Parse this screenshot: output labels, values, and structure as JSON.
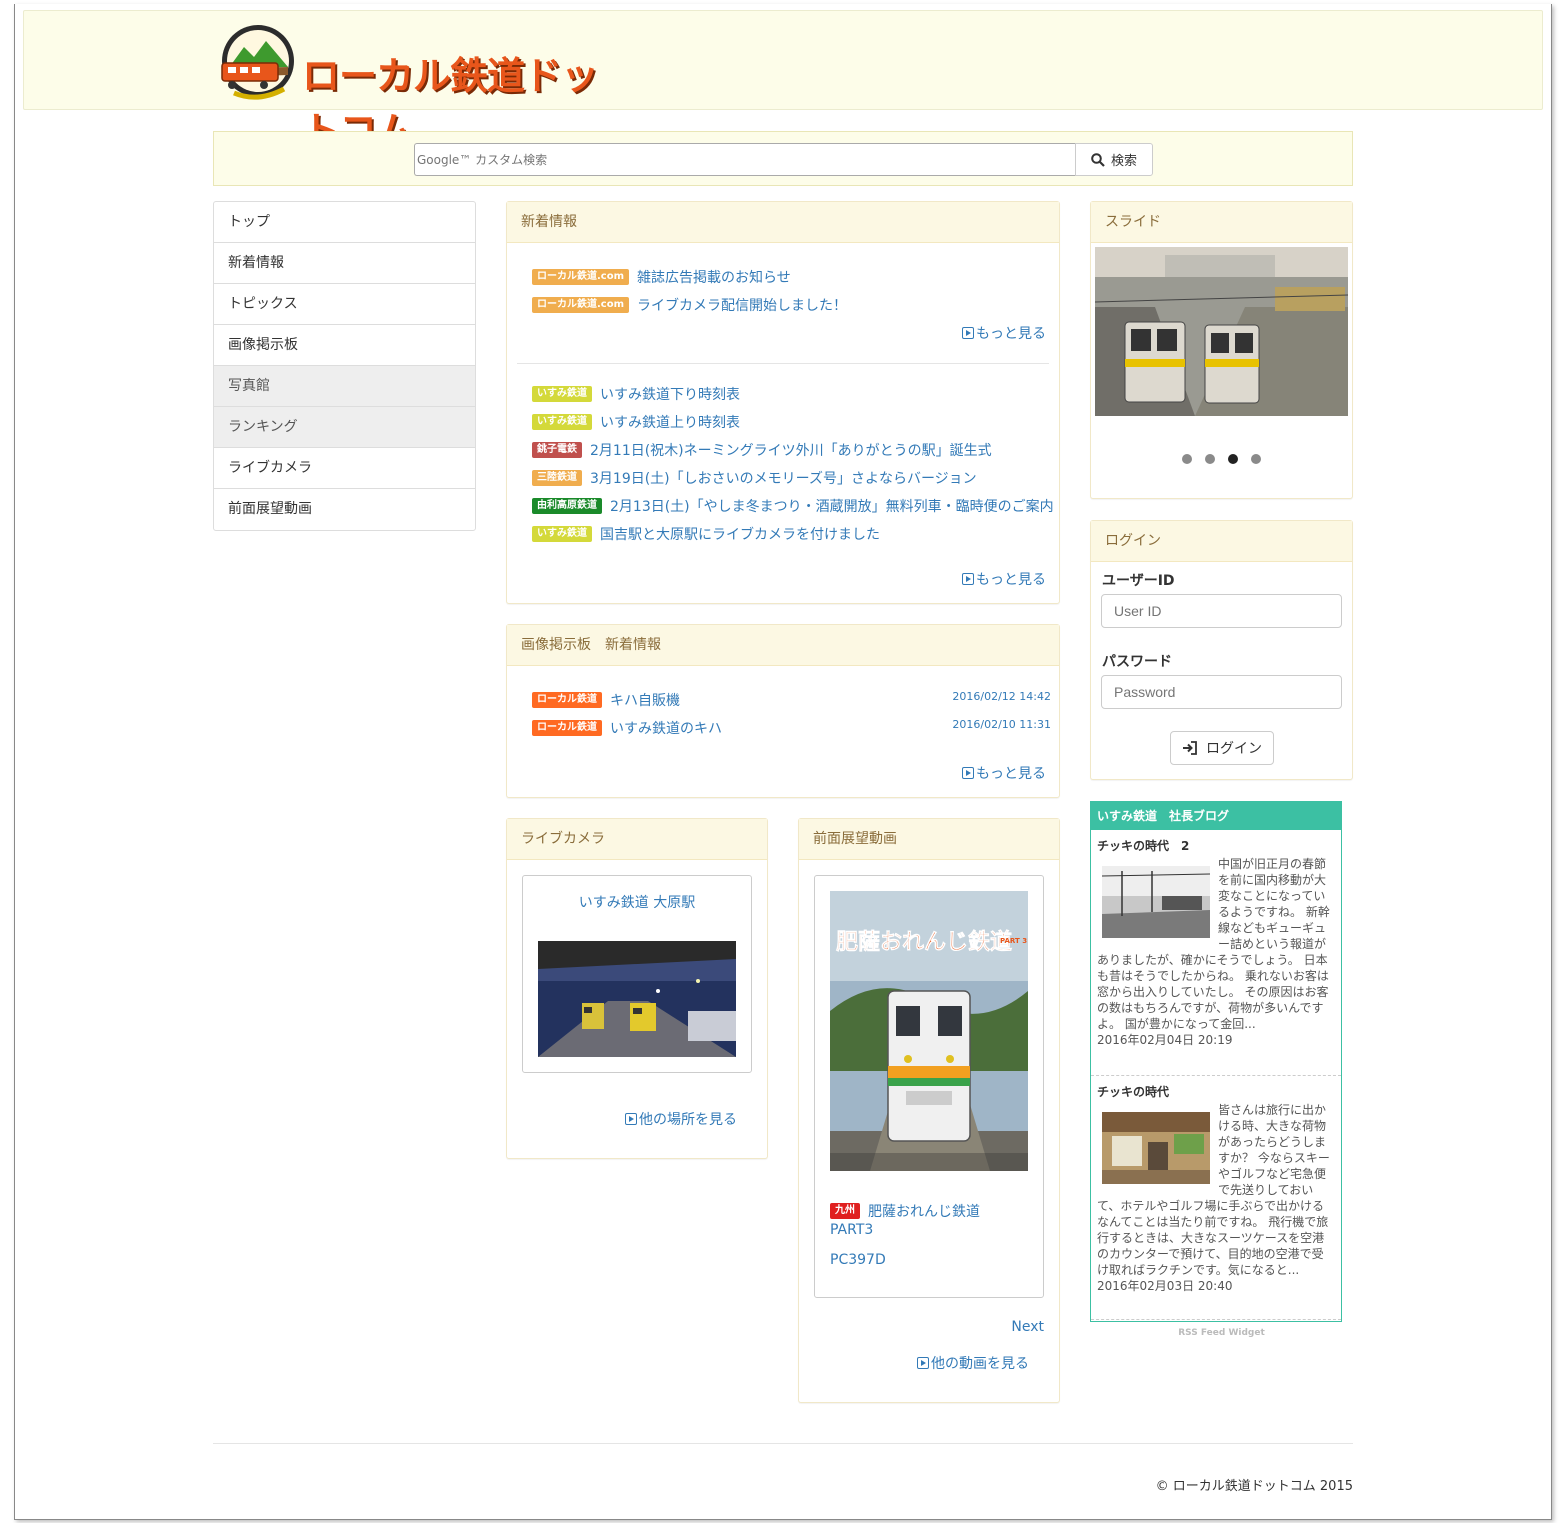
{
  "header": {
    "logo_text": "ローカル鉄道ドットコム"
  },
  "search": {
    "placeholder": "Google™ カスタム検索",
    "button_label": "検索"
  },
  "nav": {
    "items": [
      {
        "label": "トップ"
      },
      {
        "label": "新着情報"
      },
      {
        "label": "トピックス"
      },
      {
        "label": "画像掲示板"
      },
      {
        "label": "写真館"
      },
      {
        "label": "ランキング"
      },
      {
        "label": "ライブカメラ"
      },
      {
        "label": "前面展望動画"
      }
    ]
  },
  "news": {
    "title": "新着情報",
    "site_items": [
      {
        "tag": "ローカル鉄道.com",
        "text": "雑誌広告掲載のお知らせ"
      },
      {
        "tag": "ローカル鉄道.com",
        "text": "ライブカメラ配信開始しました！"
      }
    ],
    "more1": "もっと見る",
    "line_items": [
      {
        "tag": "いすみ鉄道",
        "text": "いすみ鉄道下り時刻表"
      },
      {
        "tag": "いすみ鉄道",
        "text": "いすみ鉄道上り時刻表"
      },
      {
        "tag": "銚子電鉄",
        "text": "2月11日(祝木)ネーミングライツ外川「ありがとうの駅」誕生式"
      },
      {
        "tag": "三陸鉄道",
        "text": "3月19日(土)「しおさいのメモリーズ号」さよならバージョン"
      },
      {
        "tag": "由利高原鉄道",
        "text": "2月13日(土)「やしま冬まつり・酒蔵開放」無料列車・臨時便のご案内"
      },
      {
        "tag": "いすみ鉄道",
        "text": "国吉駅と大原駅にライブカメラを付けました"
      }
    ],
    "more2": "もっと見る"
  },
  "board": {
    "title": "画像掲示板　新着情報",
    "items": [
      {
        "tag": "ローカル鉄道",
        "text": "キハ自販機",
        "date": "2016/02/12 14:42"
      },
      {
        "tag": "ローカル鉄道",
        "text": "いすみ鉄道のキハ",
        "date": "2016/02/10 11:31"
      }
    ],
    "more": "もっと見る"
  },
  "livecam": {
    "title": "ライブカメラ",
    "station": "いすみ鉄道 大原駅",
    "more": "他の場所を見る"
  },
  "video": {
    "title": "前面展望動画",
    "cover_title": "肥薩おれんじ鉄道",
    "cover_part": "PART 3",
    "tag": "九州",
    "name": "肥薩おれんじ鉄道",
    "part": "PART3",
    "code": "PC397D",
    "next": "Next",
    "more": "他の動画を見る"
  },
  "slide": {
    "title": "スライド",
    "active_index": 2,
    "count": 4
  },
  "login": {
    "title": "ログイン",
    "user_label": "ユーザーID",
    "user_placeholder": "User ID",
    "pass_label": "パスワード",
    "pass_placeholder": "Password",
    "button_label": "ログイン"
  },
  "blog": {
    "title": "いすみ鉄道　社長ブログ",
    "entries": [
      {
        "title": "チッキの時代　2",
        "body": "中国が旧正月の春節を前に国内移動が大変なことになっているようですね。 新幹線などもギューギュー詰めという報道がありましたが、確かにそうでしょう。 日本も昔はそうでしたからね。 乗れないお客は窓から出入りしていたし。 その原因はお客の数はもちろんですが、荷物が多いんですよ。 国が豊かになって金回...",
        "date": "2016年02月04日 20:19"
      },
      {
        "title": "チッキの時代",
        "body": "皆さんは旅行に出かける時、大きな荷物があったらどうしますか？ 今ならスキーやゴルフなど宅急便で先送りしておいて、ホテルやゴルフ場に手ぶらで出かけるなんてことは当たり前ですね。 飛行機で旅行するときは、大きなスーツケースを空港のカウンターで預けて、目的地の空港で受け取ればラクチンです。気になると...",
        "date": "2016年02月03日 20:40"
      }
    ],
    "widget_label": "RSS Feed Widget"
  },
  "footer": {
    "copyright": "© ローカル鉄道ドットコム 2015"
  },
  "colors": {
    "tag_site": "#f0ad4e",
    "tag_isumi": "#d4d93a",
    "tag_choshi": "#c0504d",
    "tag_sanriku": "#f0ad4e",
    "tag_yuri": "#1a8a2a",
    "tag_local": "#ff6a22",
    "tag_kyushu": "#e02020",
    "blog_accent": "#3cc0a3"
  }
}
